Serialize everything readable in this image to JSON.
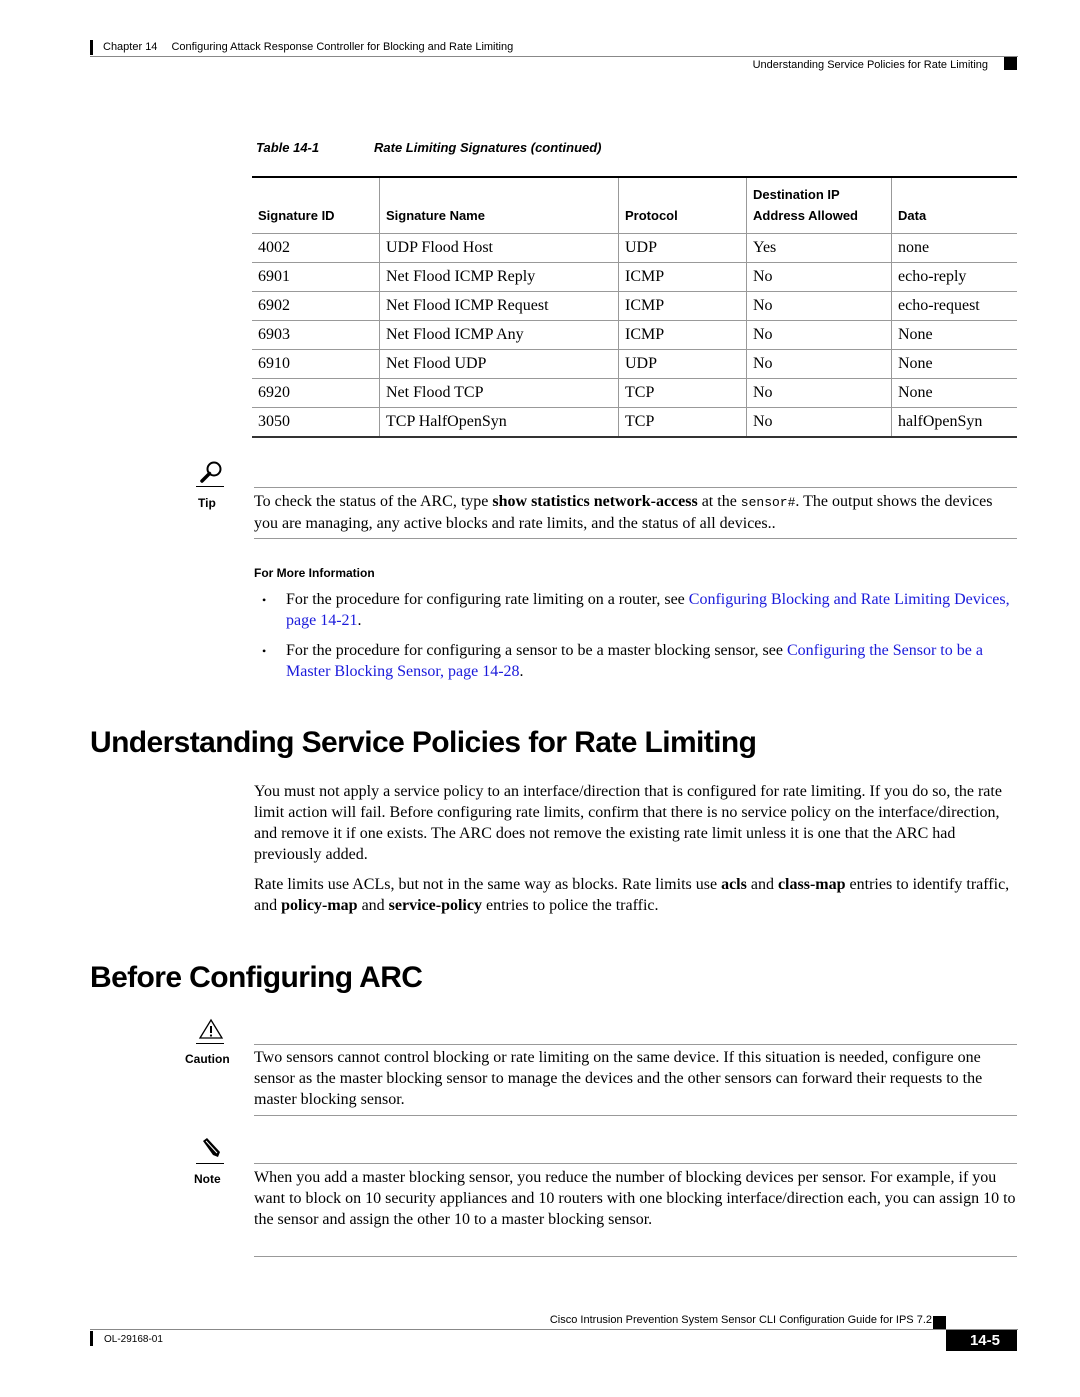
{
  "header": {
    "chapter_number": "Chapter 14",
    "chapter_title": "Configuring Attack Response Controller for Blocking and Rate Limiting",
    "section_title": "Understanding Service Policies for Rate Limiting"
  },
  "table": {
    "caption_label": "Table 14-1",
    "caption_title": "Rate Limiting Signatures (continued)",
    "columns": [
      {
        "line1": "",
        "line2": "Signature ID"
      },
      {
        "line1": "",
        "line2": "Signature Name"
      },
      {
        "line1": "",
        "line2": "Protocol"
      },
      {
        "line1": "Destination IP",
        "line2": "Address Allowed"
      },
      {
        "line1": "",
        "line2": "Data"
      }
    ],
    "rows": [
      [
        "4002",
        "UDP Flood Host",
        "UDP",
        "Yes",
        "none"
      ],
      [
        "6901",
        "Net Flood ICMP Reply",
        "ICMP",
        "No",
        "echo-reply"
      ],
      [
        "6902",
        "Net Flood ICMP Request",
        "ICMP",
        "No",
        "echo-request"
      ],
      [
        "6903",
        "Net Flood ICMP Any",
        "ICMP",
        "No",
        "None"
      ],
      [
        "6910",
        "Net Flood UDP",
        "UDP",
        "No",
        "None"
      ],
      [
        "6920",
        "Net Flood TCP",
        "TCP",
        "No",
        "None"
      ],
      [
        "3050",
        "TCP HalfOpenSyn",
        "TCP",
        "No",
        "halfOpenSyn"
      ]
    ]
  },
  "tip": {
    "icon": "magnifier-icon",
    "label": "Tip",
    "text_1": "To check the status of the ARC, type ",
    "bold_1": "show statistics network-access",
    "text_2": " at the ",
    "code_1": "sensor#",
    "text_3": ". The output shows the devices you are managing, any active blocks and rate limits, and the status of all devices.."
  },
  "more_info": {
    "heading": "For More Information",
    "bullets": [
      {
        "text": "For the procedure for configuring rate limiting on a router, see ",
        "link": "Configuring Blocking and Rate Limiting Devices, page 14-21",
        "after": "."
      },
      {
        "text": "For the procedure for configuring a sensor to be a master blocking sensor, see ",
        "link": "Configuring the Sensor to be a Master Blocking Sensor, page 14-28",
        "after": "."
      }
    ]
  },
  "section1": {
    "title": "Understanding Service Policies for Rate Limiting",
    "para1": "You must not apply a service policy to an interface/direction that is configured for rate limiting. If you do so, the rate limit action will fail. Before configuring rate limits, confirm that there is no service policy on the interface/direction, and remove it if one exists. The ARC does not remove the existing rate limit unless it is one that the ARC had previously added.",
    "para2": {
      "t1": "Rate limits use ACLs, but not in the same way as blocks. Rate limits use ",
      "b1": "acls",
      "t2": " and ",
      "b2": "class-map",
      "t3": " entries to identify traffic, and ",
      "b3": "policy-map",
      "t4": " and ",
      "b4": "service-policy",
      "t5": " entries to police the traffic."
    }
  },
  "section2": {
    "title": "Before Configuring ARC",
    "caution": {
      "icon": "warning-triangle-icon",
      "label": "Caution",
      "text": "Two sensors cannot control blocking or rate limiting on the same device. If this situation is needed, configure one sensor as the master blocking sensor to manage the devices and the other sensors can forward their requests to the master blocking sensor."
    },
    "note": {
      "icon": "pencil-icon",
      "label": "Note",
      "text": "When you add a master blocking sensor, you reduce the number of blocking devices per sensor. For example, if you want to block on 10 security appliances and 10 routers with one blocking interface/direction each, you can assign 10 to the sensor and assign the other 10 to a master blocking sensor."
    }
  },
  "footer": {
    "guide_title": "Cisco Intrusion Prevention System Sensor CLI Configuration Guide for IPS 7.2",
    "doc_number": "OL-29168-01",
    "page_number": "14-5"
  },
  "colors": {
    "link": "#1a1adb",
    "rule": "#999999",
    "text": "#000000"
  }
}
